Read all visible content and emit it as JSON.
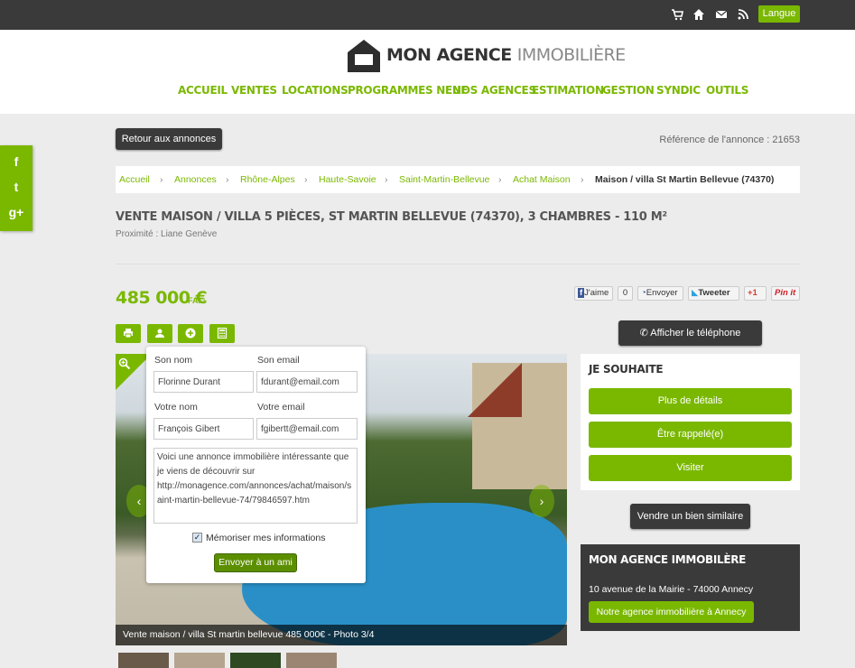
{
  "topbar": {
    "icons": [
      "cart-icon",
      "home-icon",
      "mail-icon",
      "rss-icon"
    ],
    "lang_label": "Langue"
  },
  "header": {
    "brand_main": "MON AGENCE ",
    "brand_sub": "IMMOBILIÈRE",
    "nav": [
      "ACCUEIL",
      "VENTES",
      "LOCATIONS",
      "PROGRAMMES NEUF",
      "NOS AGENCES",
      "ESTIMATION",
      "GESTION",
      "SYNDIC",
      "OUTILS"
    ]
  },
  "social": [
    "f",
    "t",
    "g+"
  ],
  "back_button": "Retour aux annonces",
  "reference": "Référence de l'annonce : 21653",
  "breadcrumb": {
    "items": [
      "Accueil",
      "Annonces",
      "Rhône-Alpes",
      "Haute-Savoie",
      "Saint-Martin-Bellevue",
      "Achat Maison"
    ],
    "current": "Maison / villa St Martin Bellevue (74370)"
  },
  "listing": {
    "title": "VENTE MAISON / VILLA 5 PIÈCES, ST MARTIN BELLEVUE (74370), 3 CHAMBRES - 110 M²",
    "proximity": "Proximité : Liane Genève",
    "price": "485 000 €",
    "price_suffix": "FAI ¹"
  },
  "share": {
    "like": "J'aime",
    "like_count": "0",
    "send": "Envoyer",
    "tweet": "Tweeter",
    "gplus": "+1",
    "pin": "Pin it"
  },
  "photo": {
    "caption": "Vente maison / villa St martin bellevue 485 000€ - Photo 3/4"
  },
  "share_form": {
    "their_name_label": "Son nom",
    "their_name_value": "Florinne Durant",
    "their_email_label": "Son email",
    "their_email_value": "fdurant@email.com",
    "your_name_label": "Votre nom",
    "your_name_value": "François Gibert",
    "your_email_label": "Votre email",
    "your_email_value": "fgibertt@email.com",
    "message": "Voici une annonce immobilière intéressante que je viens de découvrir sur http://monagence.com/annonces/achat/maison/saint-martin-bellevue-74/79846597.htm",
    "remember_label": "Mémoriser mes informations",
    "remember_checked": true,
    "submit": "Envoyer à un ami"
  },
  "actions": {
    "phone_button": "Afficher le téléphone",
    "wish_title": "JE SOUHAITE",
    "more_details": "Plus de détails",
    "call_back": "Être rappelé(e)",
    "visit": "Visiter",
    "sell_similar": "Vendre un bien similaire"
  },
  "agency": {
    "title": "MON AGENCE IMMOBILÈRE",
    "address": "10 avenue de la Mairie - 74000 Annecy",
    "link": "Notre agence immobilière à Annecy"
  }
}
